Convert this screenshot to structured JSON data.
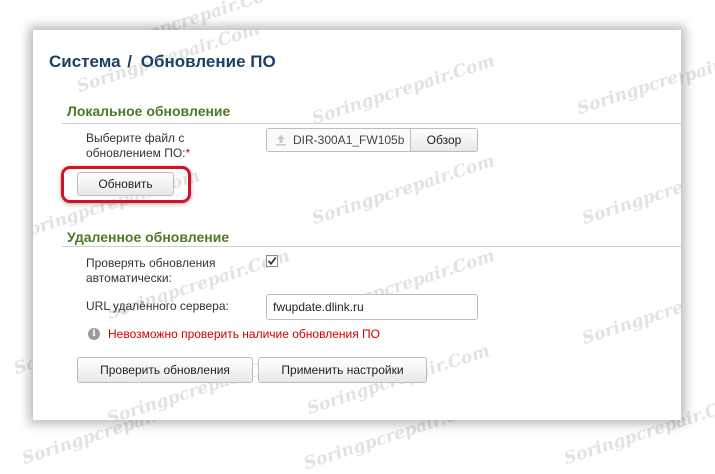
{
  "breadcrumb": {
    "parent": "Система",
    "separator": "/",
    "current": "Обновление ПО"
  },
  "local_update": {
    "section_title": "Локальное обновление",
    "file_label": "Выберите файл с обновлением ПО:",
    "required_mark": "*",
    "file_value": "DIR-300A1_FW105b",
    "browse_button": "Обзор",
    "update_button": "Обновить",
    "upload_icon": "upload-icon"
  },
  "remote_update": {
    "section_title": "Удаленное обновление",
    "auto_check_label": "Проверять обновления автоматически:",
    "auto_check_checked": true,
    "url_label": "URL удалённого сервера:",
    "url_value": "fwupdate.dlink.ru",
    "error_text": "Невозможно проверить наличие обновления ПО",
    "error_icon": "info-icon"
  },
  "buttons": {
    "check": "Проверить обновления",
    "apply": "Применить настройки"
  },
  "watermark": "Soringpcrepair.Com",
  "colors": {
    "title": "#1f3f66",
    "section": "#4b7a23",
    "error": "#d00000",
    "highlight": "#d3122a"
  }
}
